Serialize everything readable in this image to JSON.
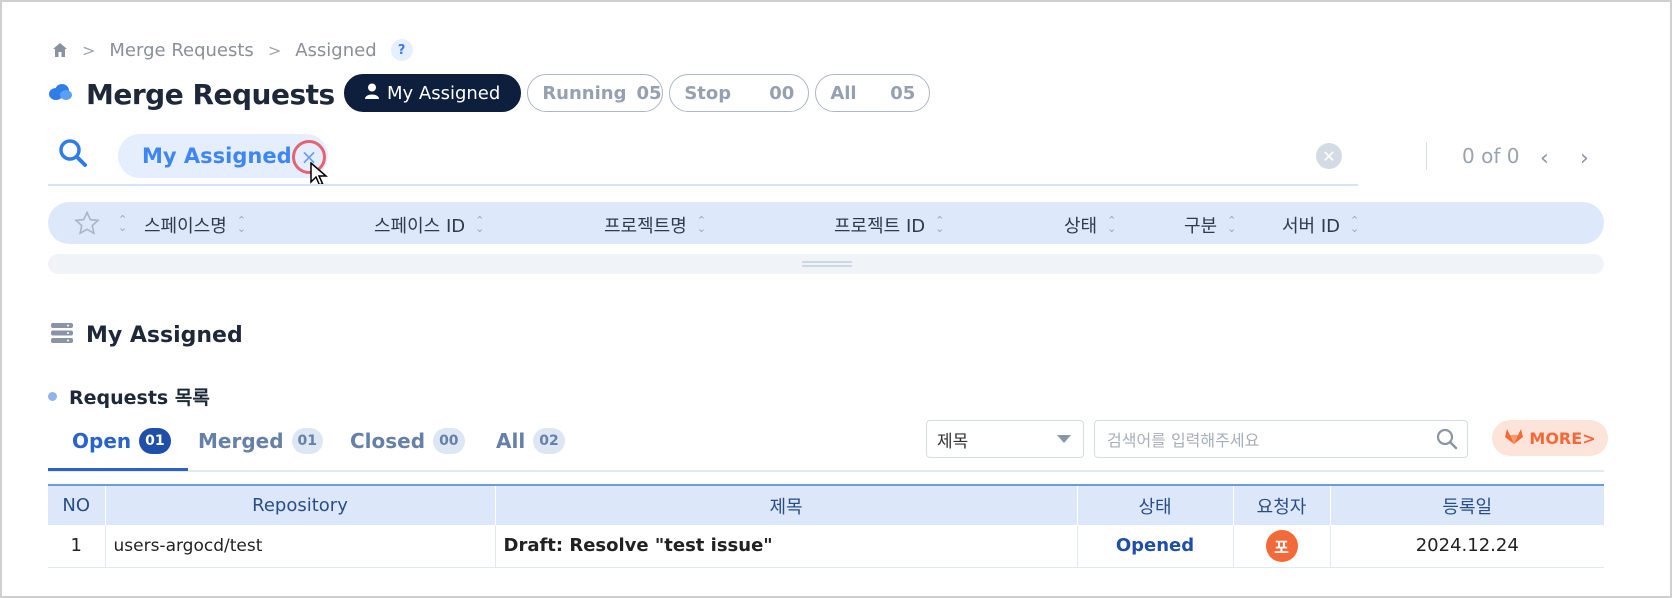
{
  "breadcrumb": {
    "home_icon": "home-icon",
    "items": [
      "Merge Requests",
      "Assigned"
    ],
    "help": "?"
  },
  "header": {
    "title": "Merge Requests",
    "title_icon": "cloud-icon",
    "filters": {
      "my_assigned": "My Assigned",
      "running_label": "Running",
      "running_count": "05",
      "stop_label": "Stop",
      "stop_count": "00",
      "all_label": "All",
      "all_count": "05"
    }
  },
  "search": {
    "chip_label": "My Assigned",
    "chip_close": "×",
    "pager_count": "0 of 0"
  },
  "columns": [
    "스페이스명",
    "스페이스 ID",
    "프로젝트명",
    "프로젝트 ID",
    "상태",
    "구분",
    "서버 ID"
  ],
  "section": {
    "title": "My Assigned",
    "subtitle": "Requests 목록"
  },
  "tabs": [
    {
      "label": "Open",
      "count": "01"
    },
    {
      "label": "Merged",
      "count": "01"
    },
    {
      "label": "Closed",
      "count": "00"
    },
    {
      "label": "All",
      "count": "02"
    }
  ],
  "filter_bar": {
    "select_value": "제목",
    "search_placeholder": "검색어를 입력해주세요",
    "more_label": "MORE"
  },
  "table": {
    "headers": {
      "no": "NO",
      "repo": "Repository",
      "title": "제목",
      "status": "상태",
      "requester": "요청자",
      "date": "등록일"
    },
    "rows": [
      {
        "no": "1",
        "repo": "users-argocd/test",
        "title": "Draft: Resolve \"test issue\"",
        "status": "Opened",
        "requester": "포",
        "date": "2024.12.24"
      }
    ]
  },
  "colors": {
    "accent": "#3f86f5",
    "dark_pill": "#0d1f3c",
    "status_opened": "#1f4fa8",
    "more": "#f26a3a"
  }
}
